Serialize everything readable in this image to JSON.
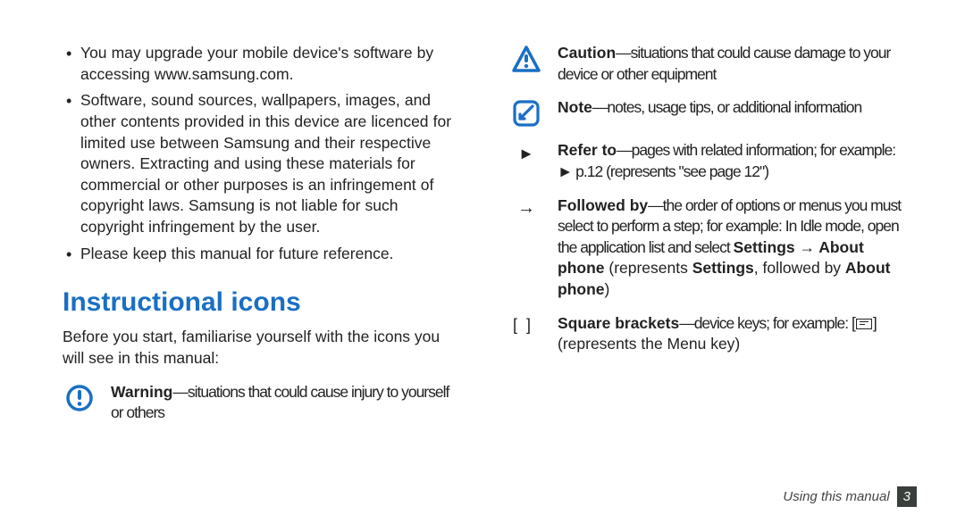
{
  "leftColumn": {
    "bullets": [
      "You may upgrade your mobile device's software by accessing www.samsung.com.",
      "Software, sound sources, wallpapers, images, and other contents provided in this device are licenced for limited use between Samsung and their respective owners. Extracting and using these materials for commercial or other purposes is an infringement of copyright laws. Samsung is not liable for such copyright infringement by the user.",
      "Please keep this manual for future reference."
    ],
    "sectionHeading": "Instructional icons",
    "intro": "Before you start, familiarise yourself with the icons you will see in this manual:"
  },
  "legend": {
    "warning": {
      "term": "Warning",
      "desc": "—situations that could cause injury to yourself or others"
    },
    "caution": {
      "term": "Caution",
      "desc": "—situations that could cause damage to your device or other equipment"
    },
    "note": {
      "term": "Note",
      "desc": "—notes, usage tips, or additional information"
    },
    "refer": {
      "term": "Refer to",
      "desc": "—pages with related information; for example: ► p.12 (represents \"see page 12\")"
    },
    "followed": {
      "term": "Followed by",
      "line1": "—the order of options or menus you must select to perform a step; for example: In Idle mode, open the application list and select ",
      "b1": "Settings → About phone",
      "mid": " (represents ",
      "b2": "Settings",
      "mid2": ", followed by ",
      "b3": "About phone",
      "tail": ")"
    },
    "square": {
      "term": "Square brackets",
      "desc_before": "—device keys; for example: [",
      "desc_after": "] (represents the Menu key)"
    },
    "symbols": {
      "triangle": "►",
      "arrow": "→",
      "bracketL": "[",
      "bracketR": "]"
    }
  },
  "footer": {
    "label": "Using this manual",
    "page": "3"
  }
}
